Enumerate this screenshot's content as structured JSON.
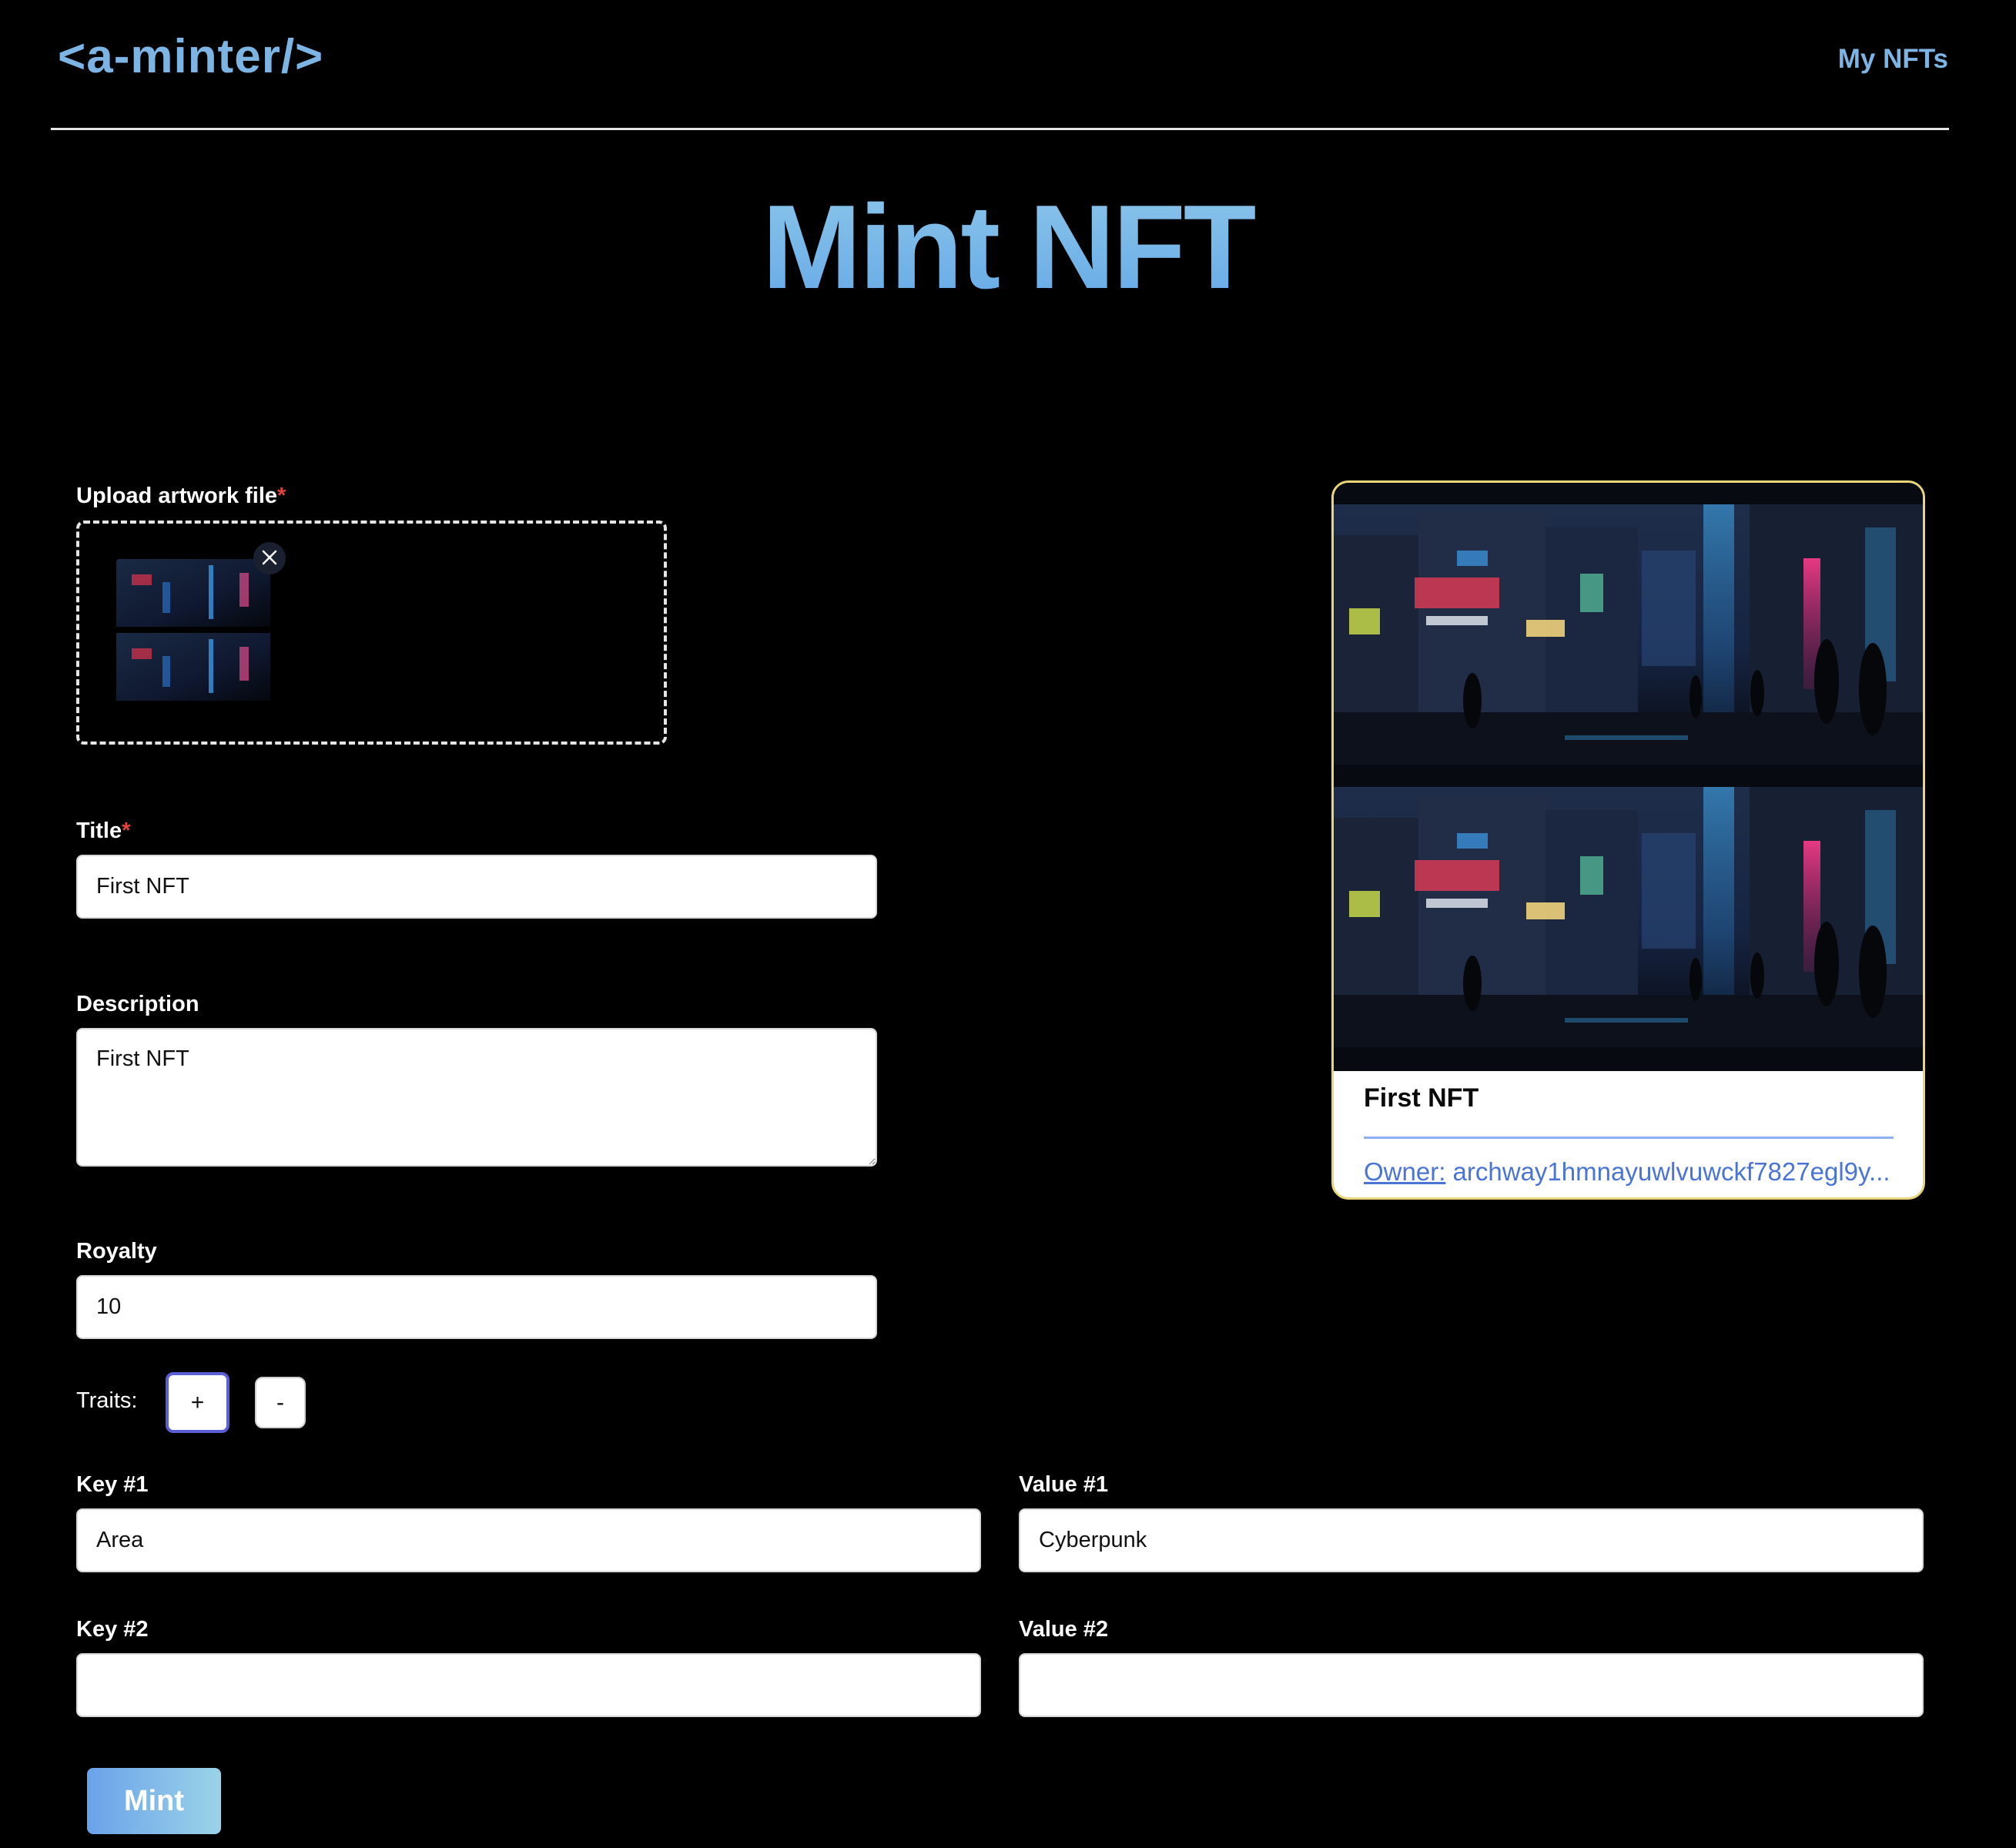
{
  "header": {
    "logo": "<a-minter/>",
    "nav_my_nfts": "My NFTs"
  },
  "page": {
    "title": "Mint NFT"
  },
  "form": {
    "upload": {
      "label": "Upload artwork file",
      "required_mark": "*"
    },
    "title_field": {
      "label": "Title",
      "required_mark": "*",
      "value": "First NFT"
    },
    "description_field": {
      "label": "Description",
      "value": "First NFT"
    },
    "royalty_field": {
      "label": "Royalty",
      "value": "10"
    },
    "traits": {
      "label": "Traits:",
      "add_label": "+",
      "remove_label": "-",
      "rows": [
        {
          "key_label": "Key #1",
          "key_value": "Area",
          "value_label": "Value #1",
          "value_value": "Cyberpunk"
        },
        {
          "key_label": "Key #2",
          "key_value": "",
          "value_label": "Value #2",
          "value_value": ""
        }
      ]
    },
    "mint_label": "Mint"
  },
  "preview_card": {
    "title": "First NFT",
    "owner_label": "Owner:",
    "owner_value": "archway1hmnayuwlvuwckf7827egl9y..."
  },
  "colors": {
    "accent": "#7cb4e4",
    "required": "#e0443a",
    "card_border": "#e9d67a",
    "owner_link": "#4a74d6"
  }
}
